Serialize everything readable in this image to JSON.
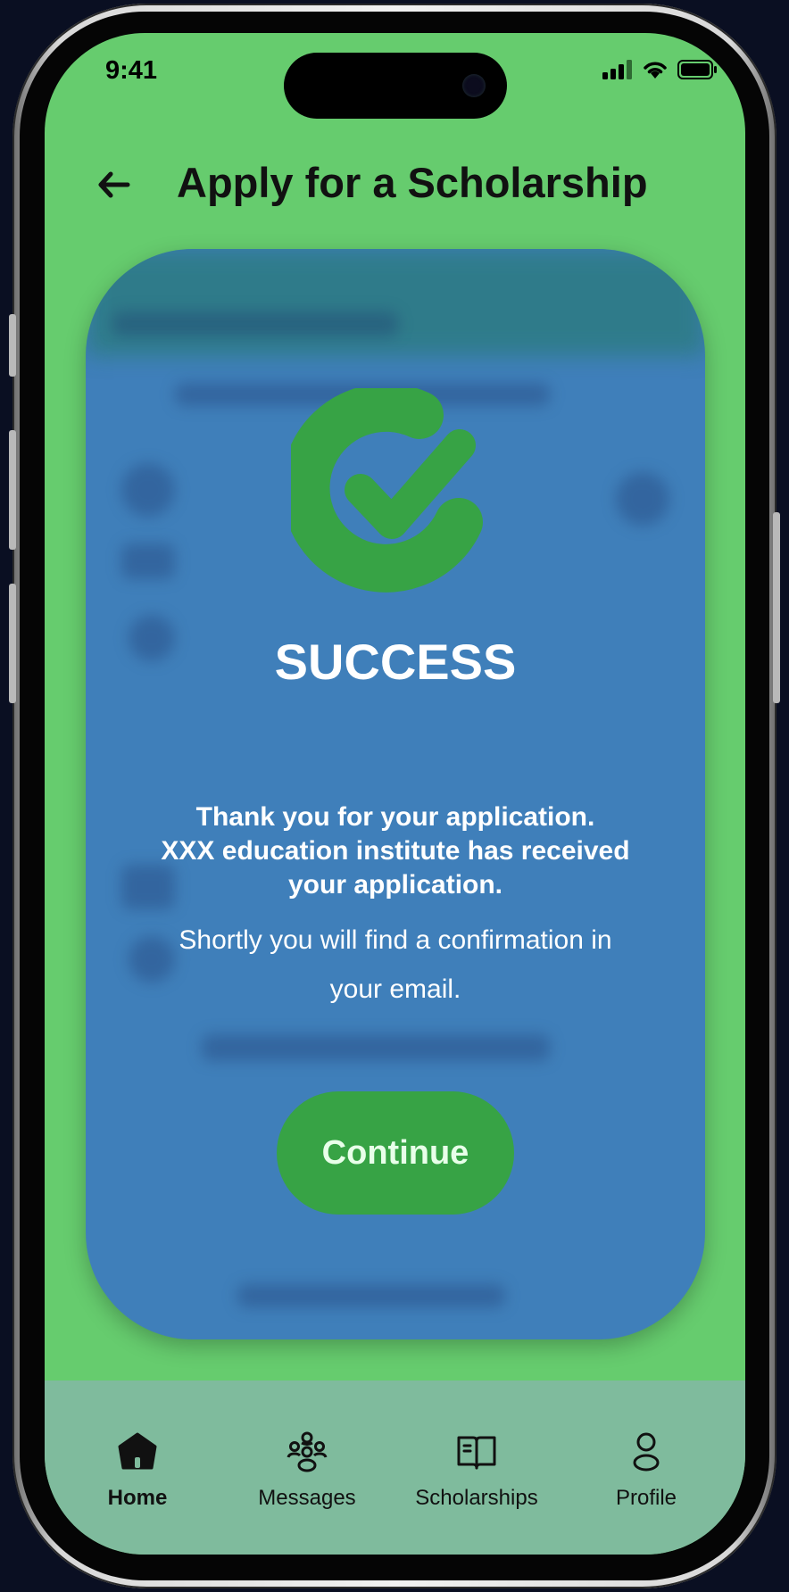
{
  "status_bar": {
    "time": "9:41"
  },
  "header": {
    "title": "Apply for a Scholarship",
    "back_icon": "arrow-left-icon"
  },
  "modal": {
    "icon": "check-circle-icon",
    "title": "SUCCESS",
    "message": "Thank you for your application.\nXXX education institute has received\nyour application.",
    "sub_message": "Shortly you will find a confirmation in\nyour email.",
    "continue_label": "Continue"
  },
  "bottom_nav": {
    "items": [
      {
        "label": "Home",
        "icon": "home-icon",
        "active": true
      },
      {
        "label": "Messages",
        "icon": "people-icon",
        "active": false
      },
      {
        "label": "Scholarships",
        "icon": "book-icon",
        "active": false
      },
      {
        "label": "Profile",
        "icon": "person-icon",
        "active": false
      }
    ]
  },
  "colors": {
    "screen_bg": "#66cc6e",
    "modal_bg": "#3f7fba",
    "accent_green": "#37a345",
    "nav_bg": "#7fbb9d"
  }
}
